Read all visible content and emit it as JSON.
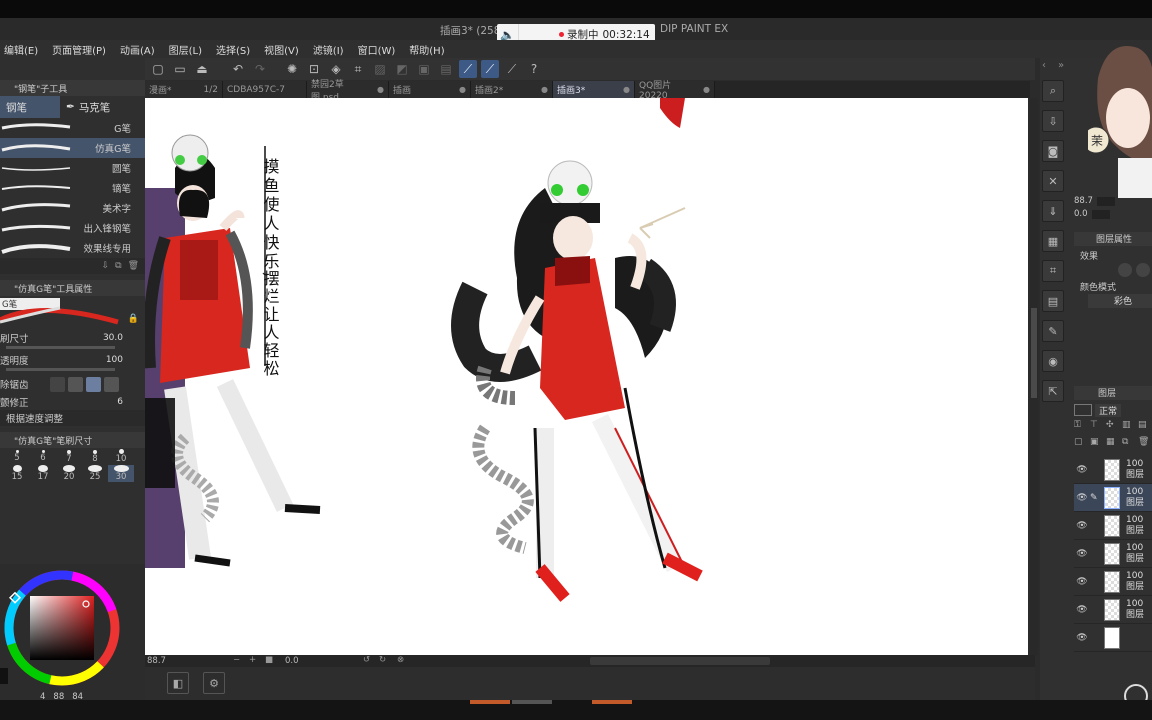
{
  "window": {
    "title": "插画3* (258",
    "title_suffix": "DIP PAINT EX",
    "recording_label": "录制中",
    "recording_time": "00:32:14"
  },
  "menu": [
    "编辑(E)",
    "页面管理(P)",
    "动画(A)",
    "图层(L)",
    "选择(S)",
    "视图(V)",
    "滤镜(I)",
    "窗口(W)",
    "帮助(H)"
  ],
  "tabs": [
    {
      "label": "漫画*",
      "extra": "1/2"
    },
    {
      "label": "CDBA957C-7 "
    },
    {
      "label": "禁园2草图.psd"
    },
    {
      "label": "插画"
    },
    {
      "label": "插画2*"
    },
    {
      "label": "插画3*"
    },
    {
      "label": "QQ图片20220"
    }
  ],
  "left_panel": {
    "subtool_header": "\"钢笔\"子工具",
    "subtool_tabs": [
      "钢笔",
      "马克笔"
    ],
    "brushes": [
      "G笔",
      "仿真G笔",
      "圆笔",
      "镝笔",
      "美术字",
      "出入锋钢笔",
      "效果线专用"
    ],
    "tool_props_header": "\"仿真G笔\"工具属性",
    "preview_label": "G笔",
    "props": [
      {
        "label": "刷尺寸",
        "value": "30.0"
      },
      {
        "label": "透明度",
        "value": "100"
      },
      {
        "label": "除锯齿",
        "value": ""
      },
      {
        "label": "颤修正",
        "value": "6"
      },
      {
        "label": "根据速度调整",
        "value": ""
      }
    ],
    "brush_size_header": "\"仿真G笔\"笔刷尺寸",
    "size_labels": [
      "5",
      "6",
      "7",
      "8",
      "10",
      "15",
      "17",
      "20",
      "25",
      "30"
    ],
    "color_values": {
      "h": "4",
      "s": "88",
      "v": "84"
    }
  },
  "canvas": {
    "vertical_text_1": "摸鱼使人快乐,",
    "vertical_text_2": "摆烂让人轻松",
    "zoom": "88.7",
    "rotation": "0.0"
  },
  "right_panel": {
    "nav_zoom": "88.7",
    "nav_rotation": "0.0",
    "layer_props_header": "图层属性",
    "effect_label": "效果",
    "color_mode_label": "颜色模式",
    "color_mode_value": "彩色",
    "layers_header": "图层",
    "blend_mode": "正常",
    "layers": [
      {
        "opacity": "100",
        "name": "图层"
      },
      {
        "opacity": "100",
        "name": "图层"
      },
      {
        "opacity": "100",
        "name": "图层"
      },
      {
        "opacity": "100",
        "name": "图层"
      },
      {
        "opacity": "100",
        "name": "图层"
      },
      {
        "opacity": "100",
        "name": "图层"
      },
      {
        "opacity": "",
        "name": ""
      }
    ]
  },
  "colors": {
    "accent": "#3d5a86",
    "red_dress": "#d8271f",
    "bg": "#2b2b2b"
  }
}
